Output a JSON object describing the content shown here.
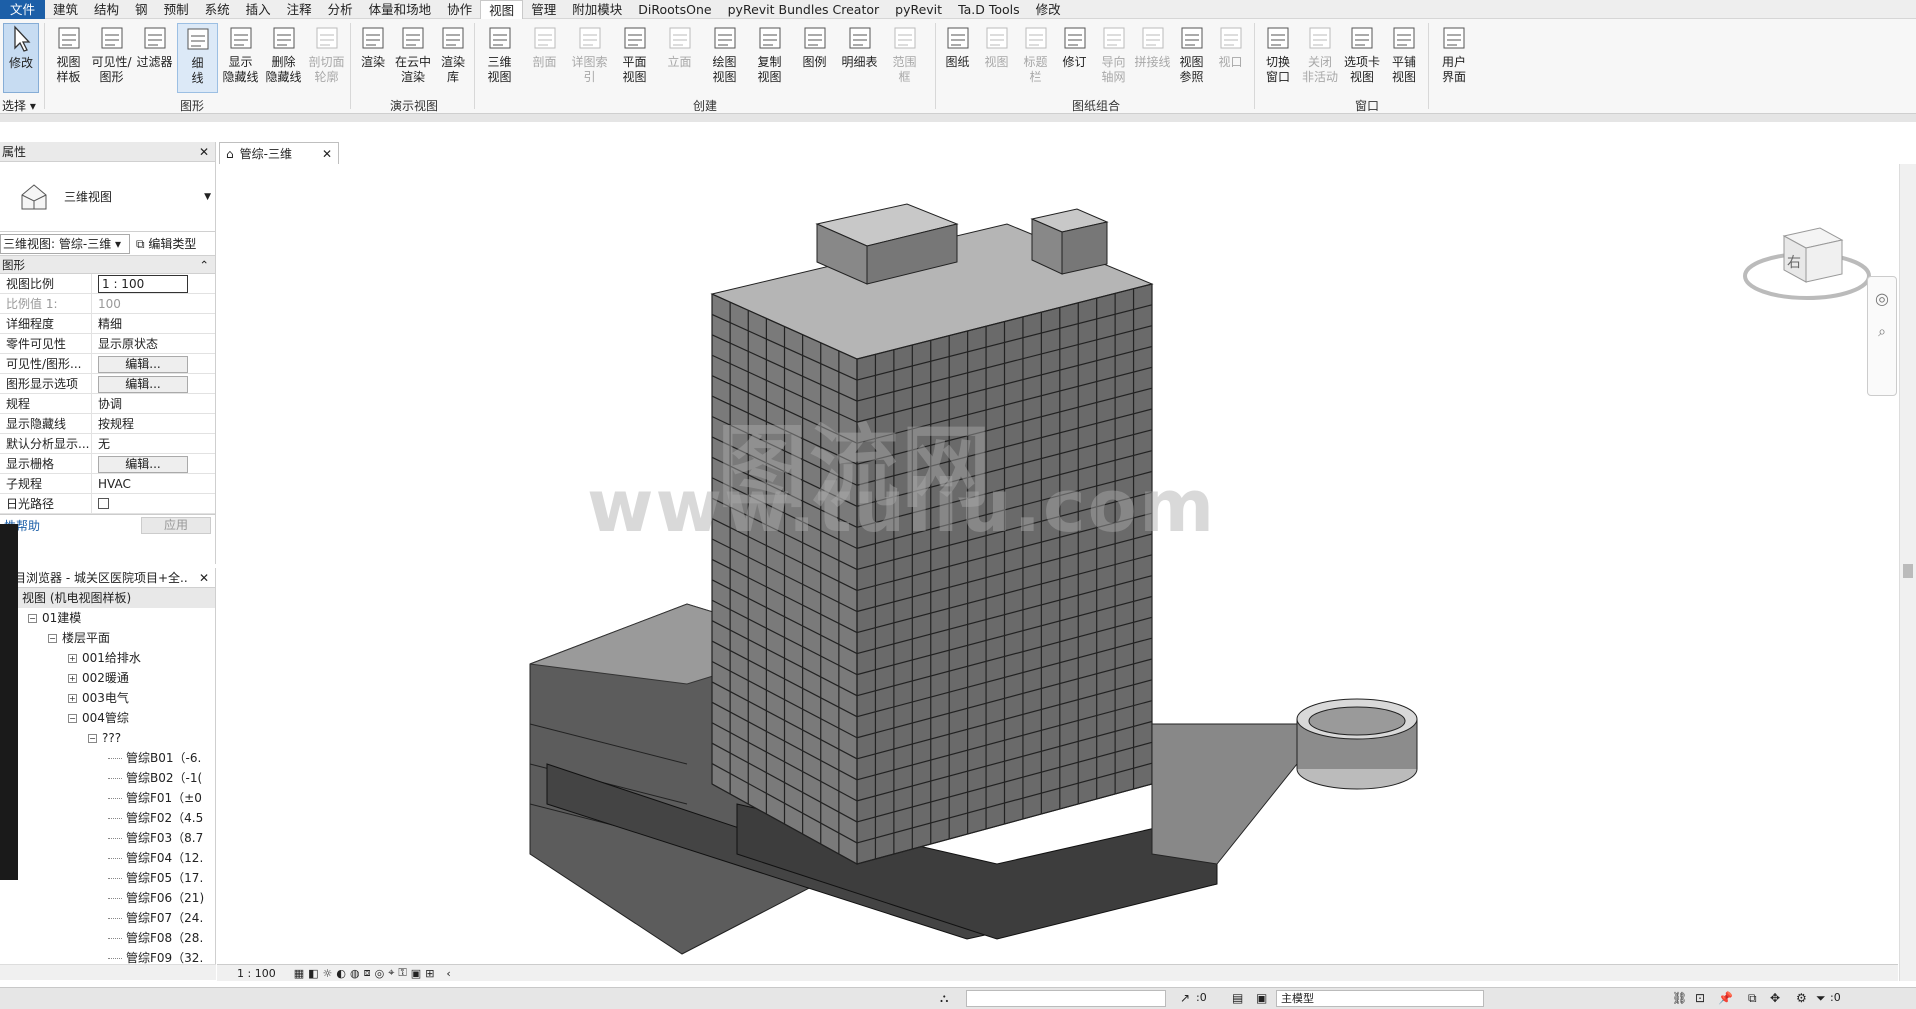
{
  "menu": [
    "文件",
    "建筑",
    "结构",
    "钢",
    "预制",
    "系统",
    "插入",
    "注释",
    "分析",
    "体量和场地",
    "协作",
    "视图",
    "管理",
    "附加模块",
    "DiRootsOne",
    "pyRevit Bundles Creator",
    "pyRevit",
    "Ta.D Tools",
    "修改"
  ],
  "ribbon": {
    "modify": "修改",
    "select": "选择",
    "g1": [
      "视图\n样板",
      "可见性/\n图形",
      "过滤器",
      "细\n线",
      "显示\n隐藏线",
      "删除\n隐藏线",
      "剖切面\n轮廓"
    ],
    "graphics_label": "图形",
    "g2": [
      "渲染",
      "在云中\n渲染",
      "渲染\n库"
    ],
    "render_label": "演示视图",
    "g3": [
      "三维\n视图",
      "剖面",
      "详图索引",
      "平面\n视图",
      "立面",
      "绘图\n视图",
      "复制\n视图",
      "图例",
      "明细表",
      "范围\n框"
    ],
    "create_label": "创建",
    "g4": [
      "图纸",
      "视图",
      "标题\n栏",
      "修订",
      "导向\n轴网",
      "拼接线",
      "视图\n参照",
      "视口"
    ],
    "sheet_label": "图纸组合",
    "g5": [
      "切换\n窗口",
      "关闭\n非活动",
      "选项卡\n视图",
      "平铺\n视图"
    ],
    "window_label": "窗口",
    "g6": [
      "用户\n界面"
    ]
  },
  "properties": {
    "title": "属性",
    "type_name": "三维视图",
    "selector": "三维视图: 管综-三维",
    "edit_type": "编辑类型",
    "section": "图形",
    "rows": [
      {
        "k": "视图比例",
        "v": "1 : 100"
      },
      {
        "k": "比例值 1:",
        "v": "100"
      },
      {
        "k": "详细程度",
        "v": "精细"
      },
      {
        "k": "零件可见性",
        "v": "显示原状态"
      },
      {
        "k": "可见性/图形...",
        "v": "编辑..."
      },
      {
        "k": "图形显示选项",
        "v": "编辑..."
      },
      {
        "k": "规程",
        "v": "协调"
      },
      {
        "k": "显示隐藏线",
        "v": "按规程"
      },
      {
        "k": "默认分析显示...",
        "v": "无"
      },
      {
        "k": "显示栅格",
        "v": "编辑..."
      },
      {
        "k": "子规程",
        "v": "HVAC"
      },
      {
        "k": "日光路径",
        "v": ""
      }
    ],
    "help": "性帮助",
    "apply": "应用"
  },
  "browser": {
    "title": "项目浏览器 - 城关区医院项目+全...",
    "items": [
      {
        "t": "视图 (机电视图样板)",
        "l": 0
      },
      {
        "t": "01建模",
        "l": 1
      },
      {
        "t": "楼层平面",
        "l": 2
      },
      {
        "t": "001给排水",
        "l": 3
      },
      {
        "t": "002暖通",
        "l": 3
      },
      {
        "t": "003电气",
        "l": 3
      },
      {
        "t": "004管综",
        "l": 3
      },
      {
        "t": "???",
        "l": 4
      },
      {
        "t": "管综B01（-6.",
        "l": 5
      },
      {
        "t": "管综B02（-1(",
        "l": 5
      },
      {
        "t": "管综F01（±0",
        "l": 5
      },
      {
        "t": "管综F02（4.5",
        "l": 5
      },
      {
        "t": "管综F03（8.7",
        "l": 5
      },
      {
        "t": "管综F04（12.",
        "l": 5
      },
      {
        "t": "管综F05（17.",
        "l": 5
      },
      {
        "t": "管综F06（21)",
        "l": 5
      },
      {
        "t": "管综F07（24.",
        "l": 5
      },
      {
        "t": "管综F08（28.",
        "l": 5
      },
      {
        "t": "管综F09（32.",
        "l": 5
      }
    ]
  },
  "view_tab": "管综-三维",
  "viewcube_face": "右",
  "viewbar_scale": "1 : 100",
  "status": {
    "zero1": ":0",
    "model": "主模型",
    "zero2": ":0"
  },
  "watermark": "www.tuliu.com"
}
